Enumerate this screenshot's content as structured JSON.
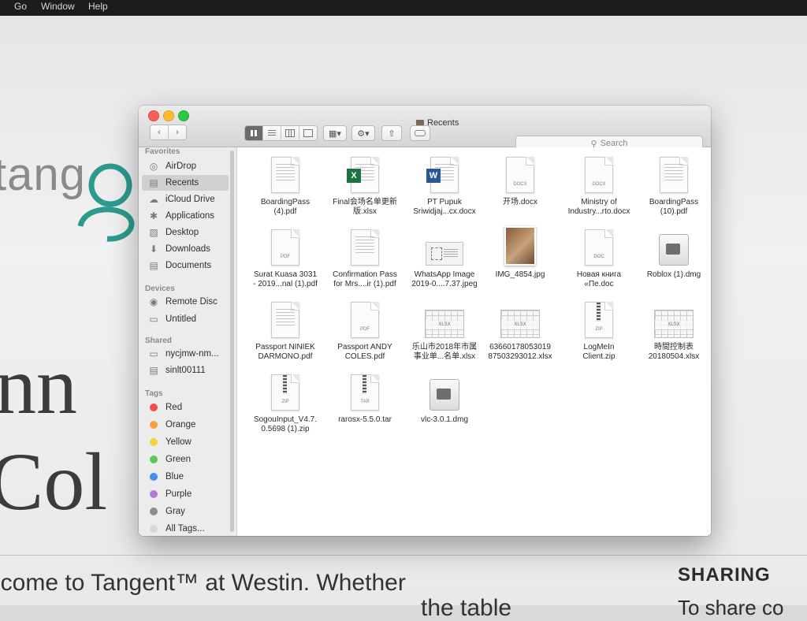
{
  "menubar": {
    "items": [
      "Go",
      "Window",
      "Help"
    ]
  },
  "background": {
    "logo_word": "tang",
    "big_text_top": "nn",
    "big_text_bottom": "Col",
    "welcome": "lcome to Tangent™ at Westin. Whether",
    "welcome_line2": "the table",
    "sharing_title": "SHARING",
    "sharing_body": "To share co"
  },
  "finder": {
    "title": "Recents",
    "search_placeholder": "Search",
    "sidebar": {
      "favorites_header": "Favorites",
      "favorites": [
        {
          "label": "AirDrop",
          "icon": "airdrop-icon"
        },
        {
          "label": "Recents",
          "icon": "recents-icon"
        },
        {
          "label": "iCloud Drive",
          "icon": "cloud-icon"
        },
        {
          "label": "Applications",
          "icon": "applications-icon"
        },
        {
          "label": "Desktop",
          "icon": "desktop-icon"
        },
        {
          "label": "Downloads",
          "icon": "downloads-icon"
        },
        {
          "label": "Documents",
          "icon": "documents-icon"
        }
      ],
      "devices_header": "Devices",
      "devices": [
        {
          "label": "Remote Disc",
          "icon": "disc-icon"
        },
        {
          "label": "Untitled",
          "icon": "drive-icon"
        }
      ],
      "shared_header": "Shared",
      "shared": [
        {
          "label": "nycjmw-nm...",
          "icon": "network-computer-icon"
        },
        {
          "label": "sinlt00111",
          "icon": "network-computer-icon"
        }
      ],
      "tags_header": "Tags",
      "tags": [
        {
          "label": "Red",
          "color": "#f24e4e"
        },
        {
          "label": "Orange",
          "color": "#f6a23a"
        },
        {
          "label": "Yellow",
          "color": "#f5d33b"
        },
        {
          "label": "Green",
          "color": "#5cc65a"
        },
        {
          "label": "Blue",
          "color": "#3d8ff2"
        },
        {
          "label": "Purple",
          "color": "#b27ad8"
        },
        {
          "label": "Gray",
          "color": "#8e8e8e"
        },
        {
          "label": "All Tags...",
          "color": "#d8d8d8"
        }
      ]
    },
    "files": [
      {
        "line1": "BoardingPass",
        "line2": "(4).pdf",
        "type": "pdf"
      },
      {
        "line1": "Final会场名单更新",
        "line2": "版.xlsx",
        "type": "xlsx"
      },
      {
        "line1": "PT Pupuk",
        "line2": "Sriwidjaj...cx.docx",
        "type": "docx-word"
      },
      {
        "line1": "开场.docx",
        "line2": "",
        "type": "docx"
      },
      {
        "line1": "Ministry of",
        "line2": "Industry...rto.docx",
        "type": "docx"
      },
      {
        "line1": "BoardingPass",
        "line2": "(10).pdf",
        "type": "pdf"
      },
      {
        "line1": "Surat Kuasa 3031",
        "line2": "- 2019...nal (1).pdf",
        "type": "pdf-plain"
      },
      {
        "line1": "Confirmation Pass",
        "line2": "for Mrs....ir (1).pdf",
        "type": "pdf"
      },
      {
        "line1": "WhatsApp Image",
        "line2": "2019-0....7.37.jpeg",
        "type": "jpeg"
      },
      {
        "line1": "IMG_4854.jpg",
        "line2": "",
        "type": "photo"
      },
      {
        "line1": "Новая книга",
        "line2": "«Пе.doc",
        "type": "doc"
      },
      {
        "line1": "Roblox (1).dmg",
        "line2": "",
        "type": "dmg"
      },
      {
        "line1": "Passport NINIEK",
        "line2": "DARMONO.pdf",
        "type": "pdf"
      },
      {
        "line1": "Passport ANDY",
        "line2": "COLES.pdf",
        "type": "pdf-plain"
      },
      {
        "line1": "乐山市2018年市属",
        "line2": "事业单...名单.xlsx",
        "type": "sheet"
      },
      {
        "line1": "63660178053019",
        "line2": "87503293012.xlsx",
        "type": "sheet"
      },
      {
        "line1": "LogMeIn",
        "line2": "Client.zip",
        "type": "zip"
      },
      {
        "line1": "時間控制表",
        "line2": "20180504.xlsx",
        "type": "sheet"
      },
      {
        "line1": "SogouInput_V4.7.",
        "line2": "0.5698 (1).zip",
        "type": "zip"
      },
      {
        "line1": "rarosx-5.5.0.tar",
        "line2": "",
        "type": "tar"
      },
      {
        "line1": "vlc-3.0.1.dmg",
        "line2": "",
        "type": "dmg"
      }
    ]
  }
}
